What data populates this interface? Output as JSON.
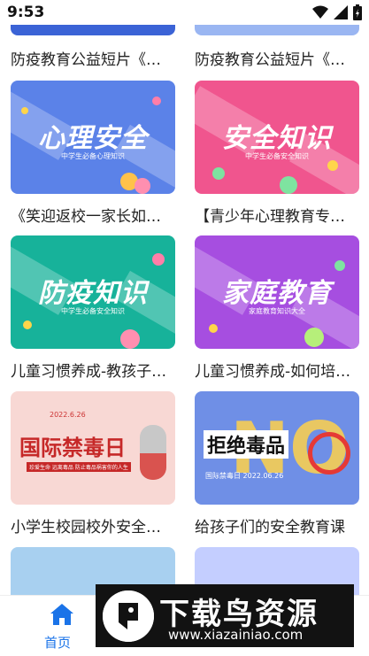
{
  "status_bar": {
    "time": "9:53"
  },
  "cards": [
    {
      "caption": "防疫教育公益短片《…"
    },
    {
      "caption": "防疫教育公益短片《…"
    },
    {
      "caption": "《笑迎返校一家长如…",
      "banner_title": "心理安全",
      "banner_sub": "中学生必备心理知识",
      "color": "#5b82e8"
    },
    {
      "caption": "【青少年心理教育专…",
      "banner_title": "安全知识",
      "banner_sub": "中学生必备安全知识",
      "color": "#f0558e"
    },
    {
      "caption": "儿童习惯养成-教孩子…",
      "banner_title": "防疫知识",
      "banner_sub": "中学生必备安全知识",
      "color": "#17b29a"
    },
    {
      "caption": "儿童习惯养成-如何培…",
      "banner_title": "家庭教育",
      "banner_sub": "家庭教育知识大全",
      "color": "#a64ee0"
    },
    {
      "caption": "小学生校园校外安全…",
      "banner_title": "国际禁毒日",
      "banner_sub": "珍爱生命 远离毒品 防止毒品祸害你的人生",
      "banner_date": "2022.6.26",
      "color": "#f8d8d4"
    },
    {
      "caption": "给孩子们的安全教育课",
      "banner_title": "拒绝毒品",
      "banner_sub": "国际禁毒日 2022.06.26",
      "banner_big": "NO",
      "color": "#6f8fe6"
    }
  ],
  "bottom_nav": {
    "home_label": "首页"
  },
  "watermark": {
    "title": "下载鸟资源",
    "url": "www.xiazainiao.com"
  }
}
